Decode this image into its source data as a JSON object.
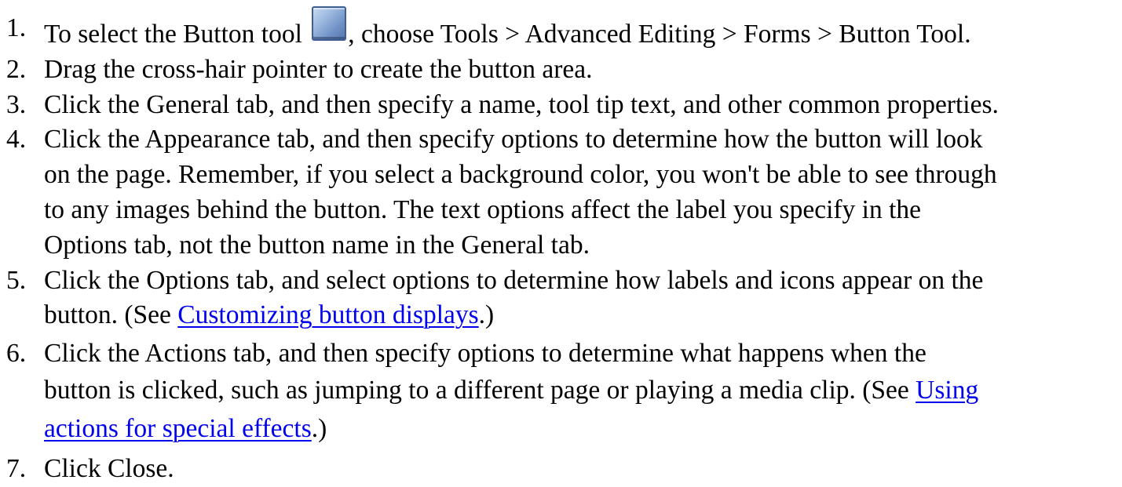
{
  "steps": [
    {
      "num": "1.",
      "before_icon": "To select the Button tool ",
      "icon": "button-tool-icon",
      "after_icon": ", choose Tools > Advanced Editing > Forms > Button Tool."
    },
    {
      "num": "2.",
      "text": "Drag the cross-hair pointer to create the button area."
    },
    {
      "num": "3.",
      "text": "Click the General tab, and then specify a name, tool tip text, and other common properties."
    },
    {
      "num": "4.",
      "lines": [
        "Click the Appearance tab, and then specify options to determine how the button will look",
        "on the page. Remember, if you select a background color, you won't be able to see through",
        "to any images behind the button. The text options affect the label you specify in the",
        "Options tab, not the button name in the General tab."
      ]
    },
    {
      "num": "5.",
      "line1": "Click the Options tab, and select options to determine how labels and icons appear on the",
      "line2_before": "button. (See ",
      "link": "Customizing button displays",
      "line2_after": ".)"
    },
    {
      "num": "6.",
      "line1": "Click the Actions tab, and then specify options to determine what happens when the",
      "line2_before": "button is clicked, such as jumping to a different page or playing a media clip. (See ",
      "link_part1": "Using",
      "link_part2": "actions for special effects",
      "line3_after": ".)"
    },
    {
      "num": "7.",
      "text": "Click Close."
    }
  ]
}
